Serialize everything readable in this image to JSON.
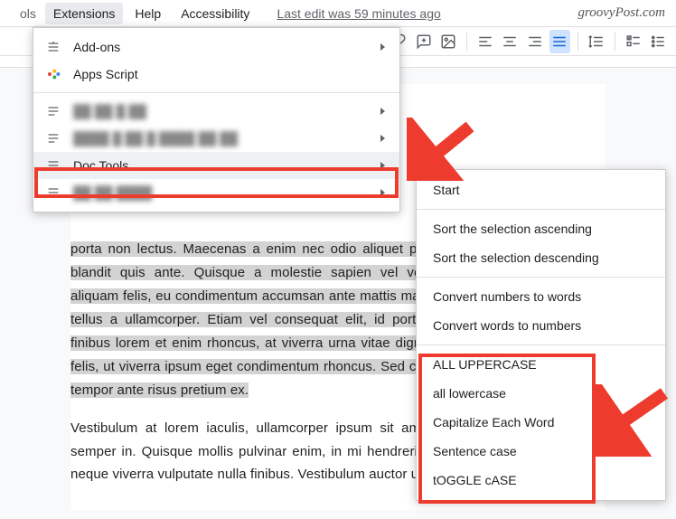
{
  "menubar": {
    "extensions": "Extensions",
    "help": "Help",
    "accessibility": "Accessibility",
    "last_edit": "Last edit was 59 minutes ago"
  },
  "brand": "groovyPost.com",
  "dropdown": {
    "addons": "Add-ons",
    "apps_script": "Apps Script",
    "blur1": "██ ██ █ ██",
    "blur2": "████ █ ██ █  ████ ██ ██",
    "doc_tools": "Doc Tools",
    "blur3": "██ ██ ████"
  },
  "submenu": {
    "start": "Start",
    "sort_asc": "Sort the selection ascending",
    "sort_desc": "Sort the selection descending",
    "num_to_words": "Convert numbers to words",
    "words_to_num": "Convert words to numbers",
    "upper": "ALL UPPERCASE",
    "lower": "all lowercase",
    "cap_each": "Capitalize Each Word",
    "sentence": "Sentence case",
    "toggle": "tOGGLE cASE"
  },
  "doc": {
    "p1": "porta non lectus. Maecenas a enim nec odio aliquet porttitor aliquet vitae cursus id, blandit quis ante. Quisque a molestie sapien vel venenatis. Pellentesque iaculis aliquam felis, eu condimentum accumsan ante mattis massa efficitur, ut scelerisque dui tellus a ullamcorper. Etiam vel consequat elit, id porttitor diam dictumst. Phasellus finibus lorem et enim rhoncus, at viverra urna vitae dignissim ornare, est nibh fringilla felis, ut viverra ipsum eget condimentum rhoncus. Sed cursus, dui eu ultricies nisi, quis tempor ante risus pretium ex.",
    "p2": "Vestibulum at lorem iaculis, ullamcorper ipsum sit amet, aliquam vitae ultrices leo semper in. Quisque mollis pulvinar enim, in mi hendrerit dolor. Cras congue urna nec neque viverra vulputate nulla finibus. Vestibulum auctor ut laoreet ipsum. Ves"
  }
}
